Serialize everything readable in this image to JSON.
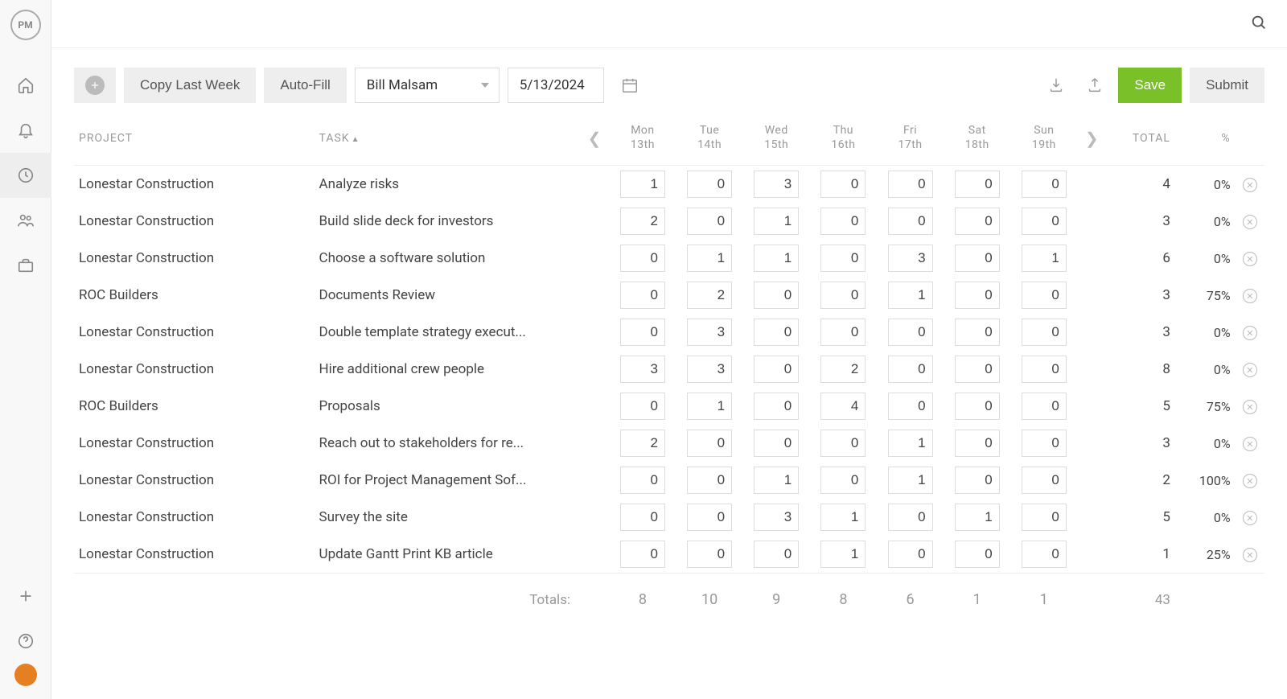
{
  "toolbar": {
    "copy_last_week": "Copy Last Week",
    "auto_fill": "Auto-Fill",
    "user": "Bill Malsam",
    "date": "5/13/2024",
    "save": "Save",
    "submit": "Submit"
  },
  "headers": {
    "project": "PROJECT",
    "task": "TASK",
    "total": "TOTAL",
    "percent": "%",
    "totals_label": "Totals:"
  },
  "days": [
    {
      "dow": "Mon",
      "date": "13th"
    },
    {
      "dow": "Tue",
      "date": "14th"
    },
    {
      "dow": "Wed",
      "date": "15th"
    },
    {
      "dow": "Thu",
      "date": "16th"
    },
    {
      "dow": "Fri",
      "date": "17th"
    },
    {
      "dow": "Sat",
      "date": "18th"
    },
    {
      "dow": "Sun",
      "date": "19th"
    }
  ],
  "rows": [
    {
      "project": "Lonestar Construction",
      "task": "Analyze risks",
      "hours": [
        1,
        0,
        3,
        0,
        0,
        0,
        0
      ],
      "total": 4,
      "pct": "0%"
    },
    {
      "project": "Lonestar Construction",
      "task": "Build slide deck for investors",
      "hours": [
        2,
        0,
        1,
        0,
        0,
        0,
        0
      ],
      "total": 3,
      "pct": "0%"
    },
    {
      "project": "Lonestar Construction",
      "task": "Choose a software solution",
      "hours": [
        0,
        1,
        1,
        0,
        3,
        0,
        1
      ],
      "total": 6,
      "pct": "0%"
    },
    {
      "project": "ROC Builders",
      "task": "Documents Review",
      "hours": [
        0,
        2,
        0,
        0,
        1,
        0,
        0
      ],
      "total": 3,
      "pct": "75%"
    },
    {
      "project": "Lonestar Construction",
      "task": "Double template strategy execut...",
      "hours": [
        0,
        3,
        0,
        0,
        0,
        0,
        0
      ],
      "total": 3,
      "pct": "0%"
    },
    {
      "project": "Lonestar Construction",
      "task": "Hire additional crew people",
      "hours": [
        3,
        3,
        0,
        2,
        0,
        0,
        0
      ],
      "total": 8,
      "pct": "0%"
    },
    {
      "project": "ROC Builders",
      "task": "Proposals",
      "hours": [
        0,
        1,
        0,
        4,
        0,
        0,
        0
      ],
      "total": 5,
      "pct": "75%"
    },
    {
      "project": "Lonestar Construction",
      "task": "Reach out to stakeholders for re...",
      "hours": [
        2,
        0,
        0,
        0,
        1,
        0,
        0
      ],
      "total": 3,
      "pct": "0%"
    },
    {
      "project": "Lonestar Construction",
      "task": "ROI for Project Management Sof...",
      "hours": [
        0,
        0,
        1,
        0,
        1,
        0,
        0
      ],
      "total": 2,
      "pct": "100%"
    },
    {
      "project": "Lonestar Construction",
      "task": "Survey the site",
      "hours": [
        0,
        0,
        3,
        1,
        0,
        1,
        0
      ],
      "total": 5,
      "pct": "0%"
    },
    {
      "project": "Lonestar Construction",
      "task": "Update Gantt Print KB article",
      "hours": [
        0,
        0,
        0,
        1,
        0,
        0,
        0
      ],
      "total": 1,
      "pct": "25%"
    }
  ],
  "totals": {
    "days": [
      8,
      10,
      9,
      8,
      6,
      1,
      1
    ],
    "grand": 43
  }
}
